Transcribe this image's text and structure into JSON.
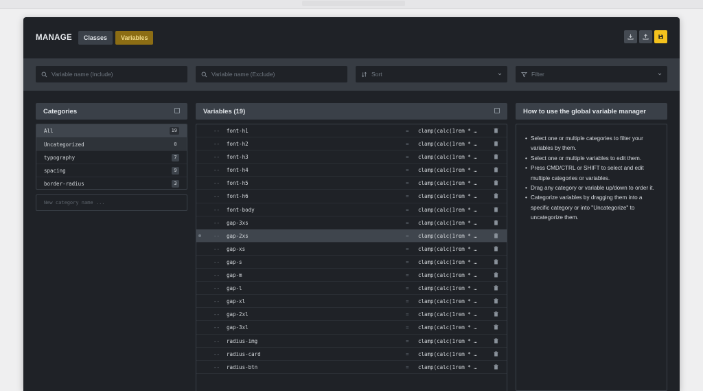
{
  "header": {
    "title": "MANAGE",
    "tabs": [
      {
        "label": "Classes",
        "active": false
      },
      {
        "label": "Variables",
        "active": true
      }
    ],
    "actions": [
      {
        "name": "download-icon"
      },
      {
        "name": "upload-icon"
      },
      {
        "name": "save-icon"
      }
    ]
  },
  "filters": {
    "include_placeholder": "Variable name (Include)",
    "exclude_placeholder": "Variable name (Exclude)",
    "sort_label": "Sort",
    "filter_label": "Filter"
  },
  "categories": {
    "title": "Categories",
    "items": [
      {
        "label": "All",
        "count": "19"
      },
      {
        "label": "Uncategorized",
        "count": "0"
      },
      {
        "label": "typography",
        "count": "7"
      },
      {
        "label": "spacing",
        "count": "9"
      },
      {
        "label": "border-radius",
        "count": "3"
      }
    ],
    "new_placeholder": "New category name ..."
  },
  "variables": {
    "title": "Variables (19)",
    "prefix": "--",
    "equals": "=",
    "items": [
      {
        "name": "font-h1",
        "value": "clamp(calc(1rem * …"
      },
      {
        "name": "font-h2",
        "value": "clamp(calc(1rem * …"
      },
      {
        "name": "font-h3",
        "value": "clamp(calc(1rem * …"
      },
      {
        "name": "font-h4",
        "value": "clamp(calc(1rem * …"
      },
      {
        "name": "font-h5",
        "value": "clamp(calc(1rem * …"
      },
      {
        "name": "font-h6",
        "value": "clamp(calc(1rem * …"
      },
      {
        "name": "font-body",
        "value": "clamp(calc(1rem * …"
      },
      {
        "name": "gap-3xs",
        "value": "clamp(calc(1rem * …"
      },
      {
        "name": "gap-2xs",
        "value": "clamp(calc(1rem * …"
      },
      {
        "name": "gap-xs",
        "value": "clamp(calc(1rem * …"
      },
      {
        "name": "gap-s",
        "value": "clamp(calc(1rem * …"
      },
      {
        "name": "gap-m",
        "value": "clamp(calc(1rem * …"
      },
      {
        "name": "gap-l",
        "value": "clamp(calc(1rem * …"
      },
      {
        "name": "gap-xl",
        "value": "clamp(calc(1rem * …"
      },
      {
        "name": "gap-2xl",
        "value": "clamp(calc(1rem * …"
      },
      {
        "name": "gap-3xl",
        "value": "clamp(calc(1rem * …"
      },
      {
        "name": "radius-img",
        "value": "clamp(calc(1rem * …"
      },
      {
        "name": "radius-card",
        "value": "clamp(calc(1rem * …"
      },
      {
        "name": "radius-btn",
        "value": "clamp(calc(1rem * …"
      }
    ]
  },
  "help": {
    "title": "How to use the global variable manager",
    "items": [
      "Select one or multiple categories to filter your variables by them.",
      "Select one or multiple variables to edit them.",
      "Press CMD/CTRL or SHIFT to select and edit multiple categories or variables.",
      "Drag any category or variable up/down to order it.",
      "Categorize variables by dragging them into a specific category or into \"Uncategorize\" to uncategorize them."
    ]
  },
  "colors": {
    "background": "#1f2227",
    "accent": "#f4c21d",
    "active_tab": "#8c6d14"
  }
}
